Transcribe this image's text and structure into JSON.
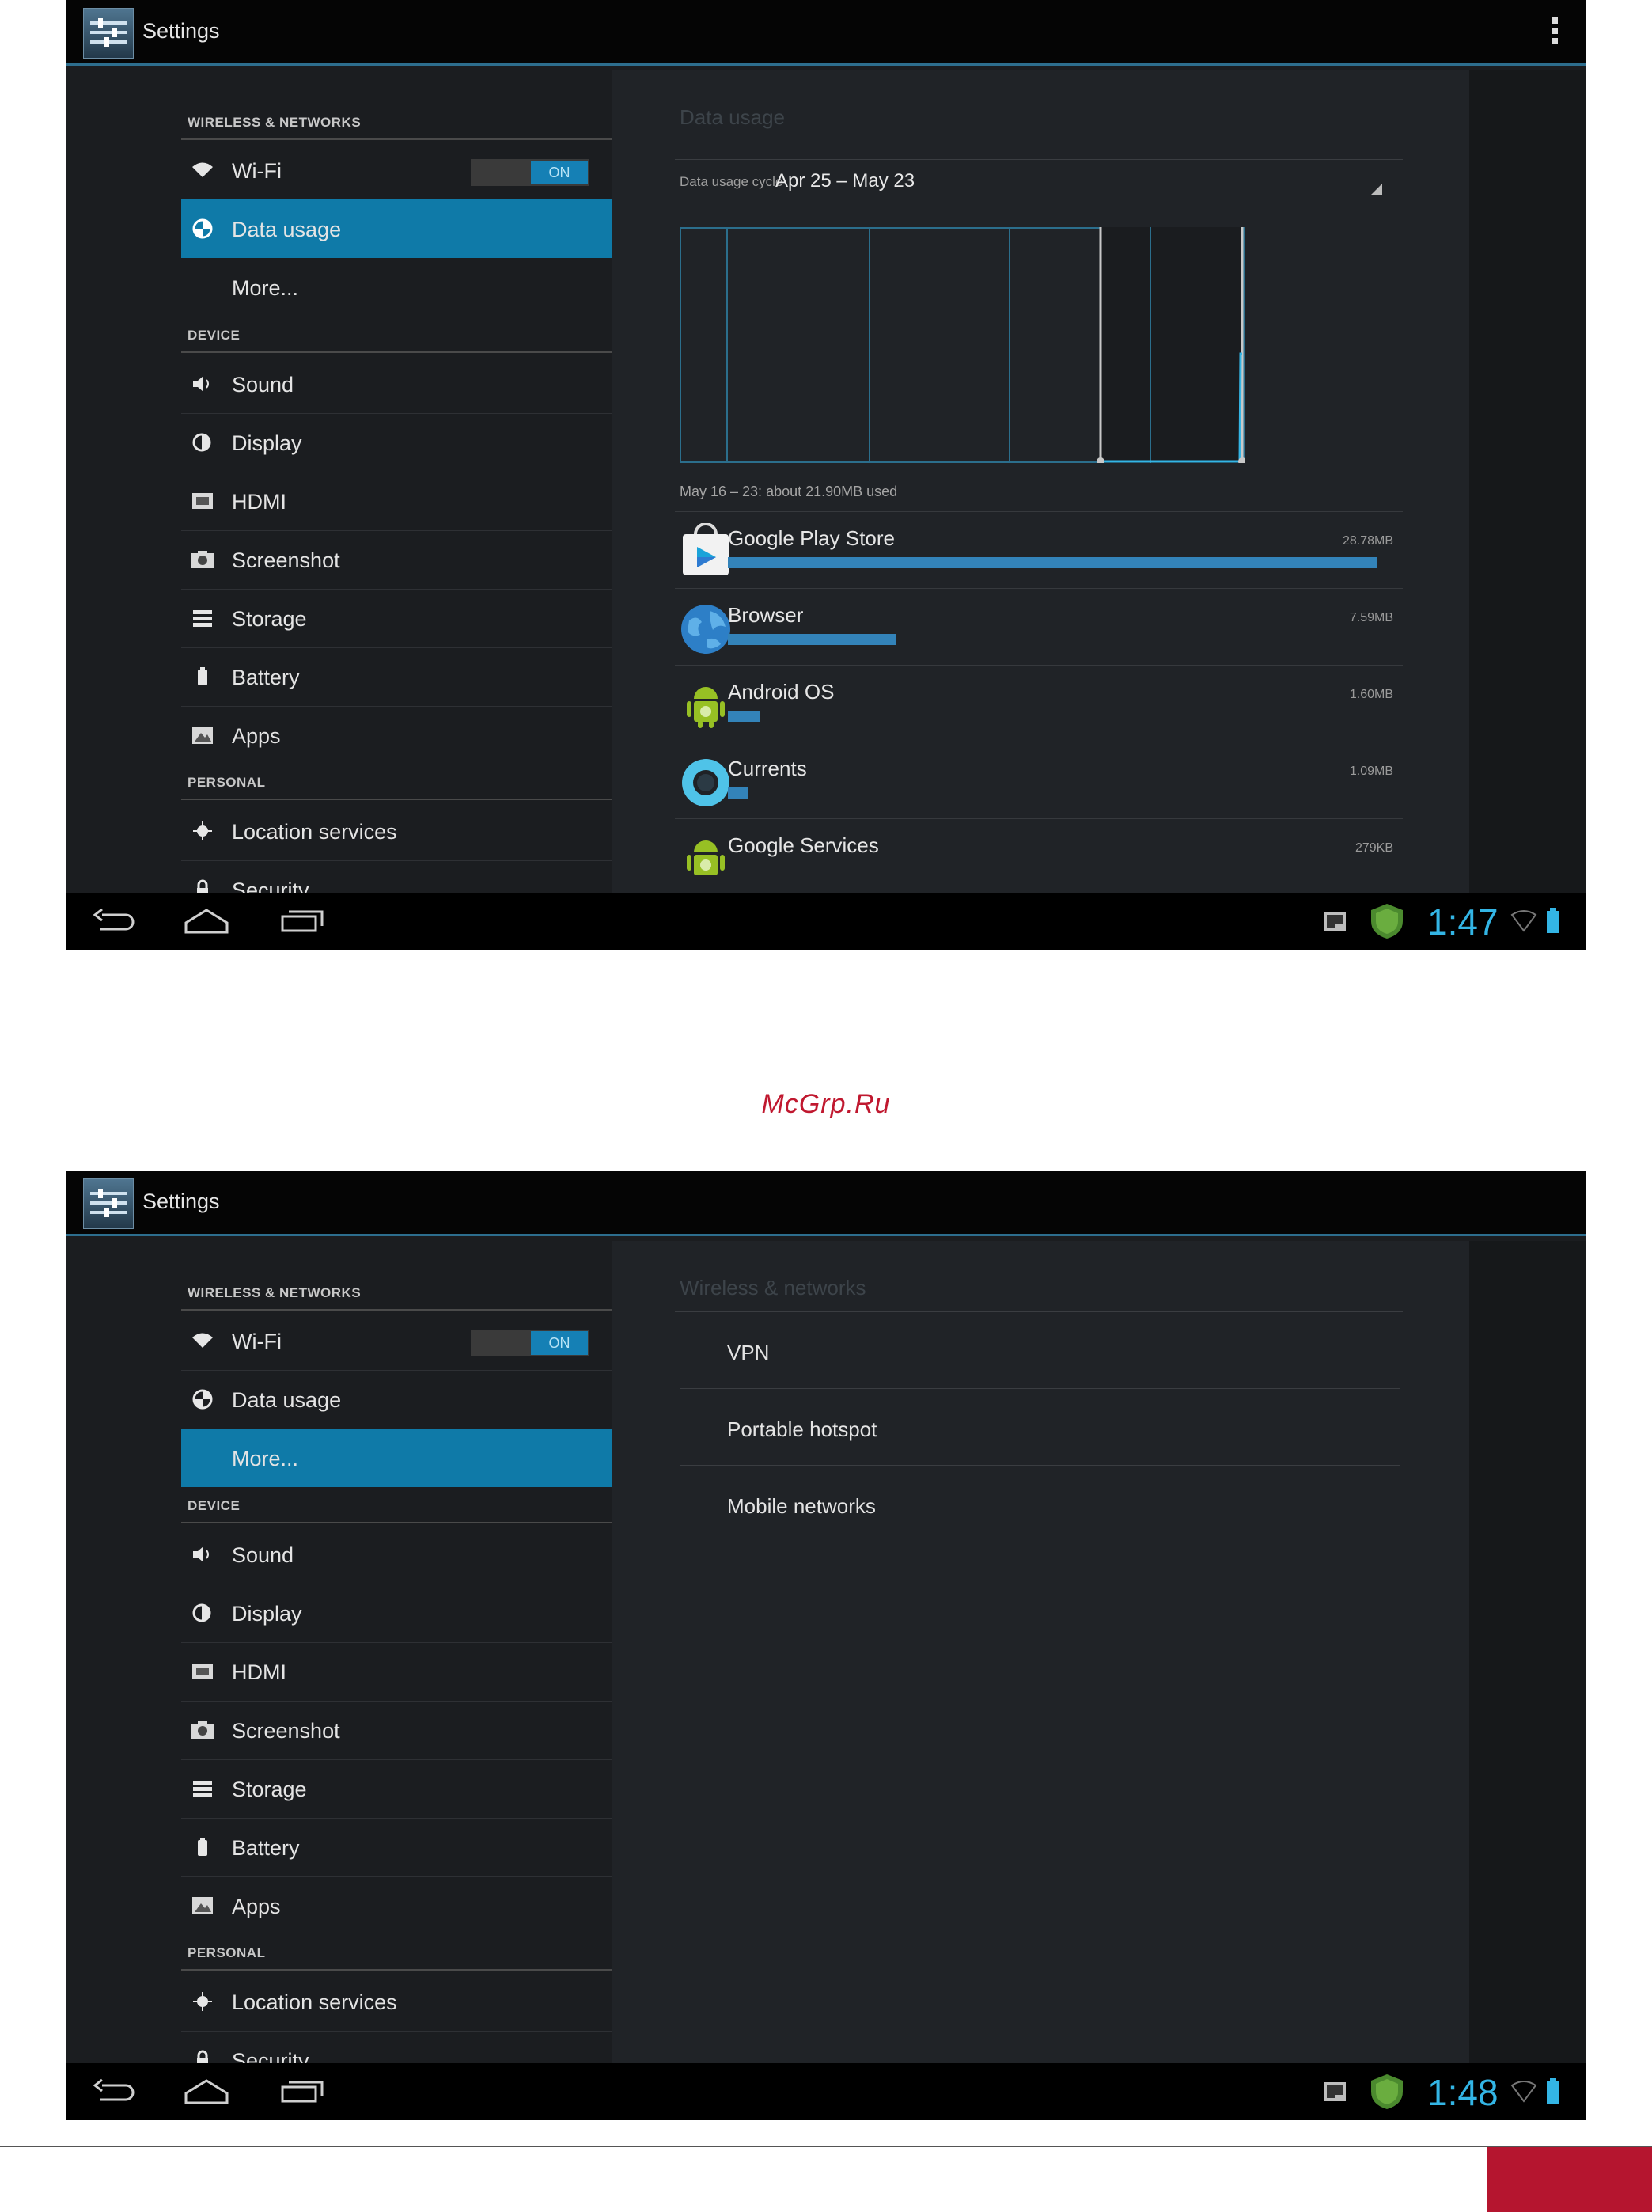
{
  "colors": {
    "accent": "#33b5e5",
    "selected": "#0f7aa8",
    "usage_bar": "#3383b9",
    "watermark": "#c0182f"
  },
  "screens": [
    {
      "action_bar": {
        "title": "Settings"
      },
      "sidebar": {
        "sections": [
          {
            "header": "WIRELESS & NETWORKS",
            "items": [
              {
                "label": "Wi-Fi",
                "icon": "wifi-icon",
                "toggle": "ON"
              },
              {
                "label": "Data usage",
                "icon": "data-usage-icon",
                "selected": true
              },
              {
                "label": "More...",
                "icon": ""
              }
            ]
          },
          {
            "header": "DEVICE",
            "items": [
              {
                "label": "Sound",
                "icon": "sound-icon"
              },
              {
                "label": "Display",
                "icon": "display-icon"
              },
              {
                "label": "HDMI",
                "icon": "hdmi-icon"
              },
              {
                "label": "Screenshot",
                "icon": "camera-icon"
              },
              {
                "label": "Storage",
                "icon": "storage-icon"
              },
              {
                "label": "Battery",
                "icon": "battery-icon"
              },
              {
                "label": "Apps",
                "icon": "apps-icon"
              }
            ]
          },
          {
            "header": "PERSONAL",
            "items": [
              {
                "label": "Location services",
                "icon": "location-icon"
              },
              {
                "label": "Security",
                "icon": "lock-icon"
              }
            ]
          }
        ]
      },
      "content": {
        "title": "Data usage",
        "cycle_label": "Data usage cycle",
        "cycle_value": "Apr 25 – May 23",
        "used_text": "May 16 – 23: about 21.90MB used",
        "apps": [
          {
            "name": "Google Play Store",
            "size": "28.78MB",
            "usage_fraction": 1.0,
            "icon": "play-store-icon"
          },
          {
            "name": "Browser",
            "size": "7.59MB",
            "usage_fraction": 0.26,
            "icon": "browser-globe-icon"
          },
          {
            "name": "Android OS",
            "size": "1.60MB",
            "usage_fraction": 0.05,
            "icon": "android-icon"
          },
          {
            "name": "Currents",
            "size": "1.09MB",
            "usage_fraction": 0.03,
            "icon": "currents-icon"
          },
          {
            "name": "Google Services",
            "size": "279KB",
            "usage_fraction": 0.01,
            "icon": "android-icon"
          }
        ]
      },
      "status_bar": {
        "time": "1:47"
      }
    },
    {
      "action_bar": {
        "title": "Settings"
      },
      "sidebar": {
        "sections": [
          {
            "header": "WIRELESS & NETWORKS",
            "items": [
              {
                "label": "Wi-Fi",
                "icon": "wifi-icon",
                "toggle": "ON"
              },
              {
                "label": "Data usage",
                "icon": "data-usage-icon"
              },
              {
                "label": "More...",
                "icon": "",
                "selected": true
              }
            ]
          },
          {
            "header": "DEVICE",
            "items": [
              {
                "label": "Sound",
                "icon": "sound-icon"
              },
              {
                "label": "Display",
                "icon": "display-icon"
              },
              {
                "label": "HDMI",
                "icon": "hdmi-icon"
              },
              {
                "label": "Screenshot",
                "icon": "camera-icon"
              },
              {
                "label": "Storage",
                "icon": "storage-icon"
              },
              {
                "label": "Battery",
                "icon": "battery-icon"
              },
              {
                "label": "Apps",
                "icon": "apps-icon"
              }
            ]
          },
          {
            "header": "PERSONAL",
            "items": [
              {
                "label": "Location services",
                "icon": "location-icon"
              },
              {
                "label": "Security",
                "icon": "lock-icon"
              }
            ]
          }
        ]
      },
      "content": {
        "title": "Wireless & networks",
        "items": [
          "VPN",
          "Portable hotspot",
          "Mobile networks"
        ]
      },
      "status_bar": {
        "time": "1:48"
      }
    }
  ],
  "watermark": "McGrp.Ru"
}
